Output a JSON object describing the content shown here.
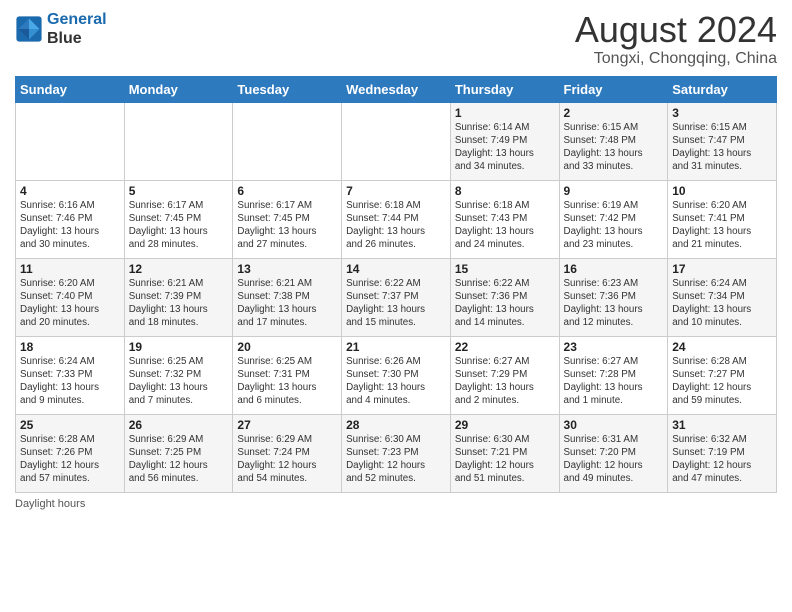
{
  "header": {
    "logo_line1": "General",
    "logo_line2": "Blue",
    "main_title": "August 2024",
    "subtitle": "Tongxi, Chongqing, China"
  },
  "weekdays": [
    "Sunday",
    "Monday",
    "Tuesday",
    "Wednesday",
    "Thursday",
    "Friday",
    "Saturday"
  ],
  "weeks": [
    [
      {
        "day": "",
        "info": ""
      },
      {
        "day": "",
        "info": ""
      },
      {
        "day": "",
        "info": ""
      },
      {
        "day": "",
        "info": ""
      },
      {
        "day": "1",
        "info": "Sunrise: 6:14 AM\nSunset: 7:49 PM\nDaylight: 13 hours\nand 34 minutes."
      },
      {
        "day": "2",
        "info": "Sunrise: 6:15 AM\nSunset: 7:48 PM\nDaylight: 13 hours\nand 33 minutes."
      },
      {
        "day": "3",
        "info": "Sunrise: 6:15 AM\nSunset: 7:47 PM\nDaylight: 13 hours\nand 31 minutes."
      }
    ],
    [
      {
        "day": "4",
        "info": "Sunrise: 6:16 AM\nSunset: 7:46 PM\nDaylight: 13 hours\nand 30 minutes."
      },
      {
        "day": "5",
        "info": "Sunrise: 6:17 AM\nSunset: 7:45 PM\nDaylight: 13 hours\nand 28 minutes."
      },
      {
        "day": "6",
        "info": "Sunrise: 6:17 AM\nSunset: 7:45 PM\nDaylight: 13 hours\nand 27 minutes."
      },
      {
        "day": "7",
        "info": "Sunrise: 6:18 AM\nSunset: 7:44 PM\nDaylight: 13 hours\nand 26 minutes."
      },
      {
        "day": "8",
        "info": "Sunrise: 6:18 AM\nSunset: 7:43 PM\nDaylight: 13 hours\nand 24 minutes."
      },
      {
        "day": "9",
        "info": "Sunrise: 6:19 AM\nSunset: 7:42 PM\nDaylight: 13 hours\nand 23 minutes."
      },
      {
        "day": "10",
        "info": "Sunrise: 6:20 AM\nSunset: 7:41 PM\nDaylight: 13 hours\nand 21 minutes."
      }
    ],
    [
      {
        "day": "11",
        "info": "Sunrise: 6:20 AM\nSunset: 7:40 PM\nDaylight: 13 hours\nand 20 minutes."
      },
      {
        "day": "12",
        "info": "Sunrise: 6:21 AM\nSunset: 7:39 PM\nDaylight: 13 hours\nand 18 minutes."
      },
      {
        "day": "13",
        "info": "Sunrise: 6:21 AM\nSunset: 7:38 PM\nDaylight: 13 hours\nand 17 minutes."
      },
      {
        "day": "14",
        "info": "Sunrise: 6:22 AM\nSunset: 7:37 PM\nDaylight: 13 hours\nand 15 minutes."
      },
      {
        "day": "15",
        "info": "Sunrise: 6:22 AM\nSunset: 7:36 PM\nDaylight: 13 hours\nand 14 minutes."
      },
      {
        "day": "16",
        "info": "Sunrise: 6:23 AM\nSunset: 7:36 PM\nDaylight: 13 hours\nand 12 minutes."
      },
      {
        "day": "17",
        "info": "Sunrise: 6:24 AM\nSunset: 7:34 PM\nDaylight: 13 hours\nand 10 minutes."
      }
    ],
    [
      {
        "day": "18",
        "info": "Sunrise: 6:24 AM\nSunset: 7:33 PM\nDaylight: 13 hours\nand 9 minutes."
      },
      {
        "day": "19",
        "info": "Sunrise: 6:25 AM\nSunset: 7:32 PM\nDaylight: 13 hours\nand 7 minutes."
      },
      {
        "day": "20",
        "info": "Sunrise: 6:25 AM\nSunset: 7:31 PM\nDaylight: 13 hours\nand 6 minutes."
      },
      {
        "day": "21",
        "info": "Sunrise: 6:26 AM\nSunset: 7:30 PM\nDaylight: 13 hours\nand 4 minutes."
      },
      {
        "day": "22",
        "info": "Sunrise: 6:27 AM\nSunset: 7:29 PM\nDaylight: 13 hours\nand 2 minutes."
      },
      {
        "day": "23",
        "info": "Sunrise: 6:27 AM\nSunset: 7:28 PM\nDaylight: 13 hours\nand 1 minute."
      },
      {
        "day": "24",
        "info": "Sunrise: 6:28 AM\nSunset: 7:27 PM\nDaylight: 12 hours\nand 59 minutes."
      }
    ],
    [
      {
        "day": "25",
        "info": "Sunrise: 6:28 AM\nSunset: 7:26 PM\nDaylight: 12 hours\nand 57 minutes."
      },
      {
        "day": "26",
        "info": "Sunrise: 6:29 AM\nSunset: 7:25 PM\nDaylight: 12 hours\nand 56 minutes."
      },
      {
        "day": "27",
        "info": "Sunrise: 6:29 AM\nSunset: 7:24 PM\nDaylight: 12 hours\nand 54 minutes."
      },
      {
        "day": "28",
        "info": "Sunrise: 6:30 AM\nSunset: 7:23 PM\nDaylight: 12 hours\nand 52 minutes."
      },
      {
        "day": "29",
        "info": "Sunrise: 6:30 AM\nSunset: 7:21 PM\nDaylight: 12 hours\nand 51 minutes."
      },
      {
        "day": "30",
        "info": "Sunrise: 6:31 AM\nSunset: 7:20 PM\nDaylight: 12 hours\nand 49 minutes."
      },
      {
        "day": "31",
        "info": "Sunrise: 6:32 AM\nSunset: 7:19 PM\nDaylight: 12 hours\nand 47 minutes."
      }
    ]
  ],
  "footer": {
    "note": "Daylight hours"
  }
}
